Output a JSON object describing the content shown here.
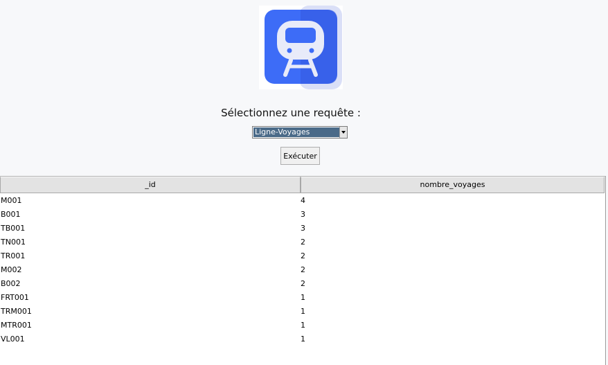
{
  "logo": {
    "icon": "train-icon",
    "colors": {
      "primary": "#3d6cf7",
      "secondary": "#dadff7",
      "glyph": "#e8ebf9"
    }
  },
  "prompt_label": "Sélectionnez une requête :",
  "query_select": {
    "selected": "Ligne-Voyages"
  },
  "execute_button": "Exécuter",
  "table": {
    "columns": [
      "_id",
      "nombre_voyages"
    ],
    "rows": [
      {
        "id": "M001",
        "count": "4"
      },
      {
        "id": "B001",
        "count": "3"
      },
      {
        "id": "TB001",
        "count": "3"
      },
      {
        "id": "TN001",
        "count": "2"
      },
      {
        "id": "TR001",
        "count": "2"
      },
      {
        "id": "M002",
        "count": "2"
      },
      {
        "id": "B002",
        "count": "2"
      },
      {
        "id": "FRT001",
        "count": "1"
      },
      {
        "id": "TRM001",
        "count": "1"
      },
      {
        "id": "MTR001",
        "count": "1"
      },
      {
        "id": "VL001",
        "count": "1"
      }
    ]
  }
}
